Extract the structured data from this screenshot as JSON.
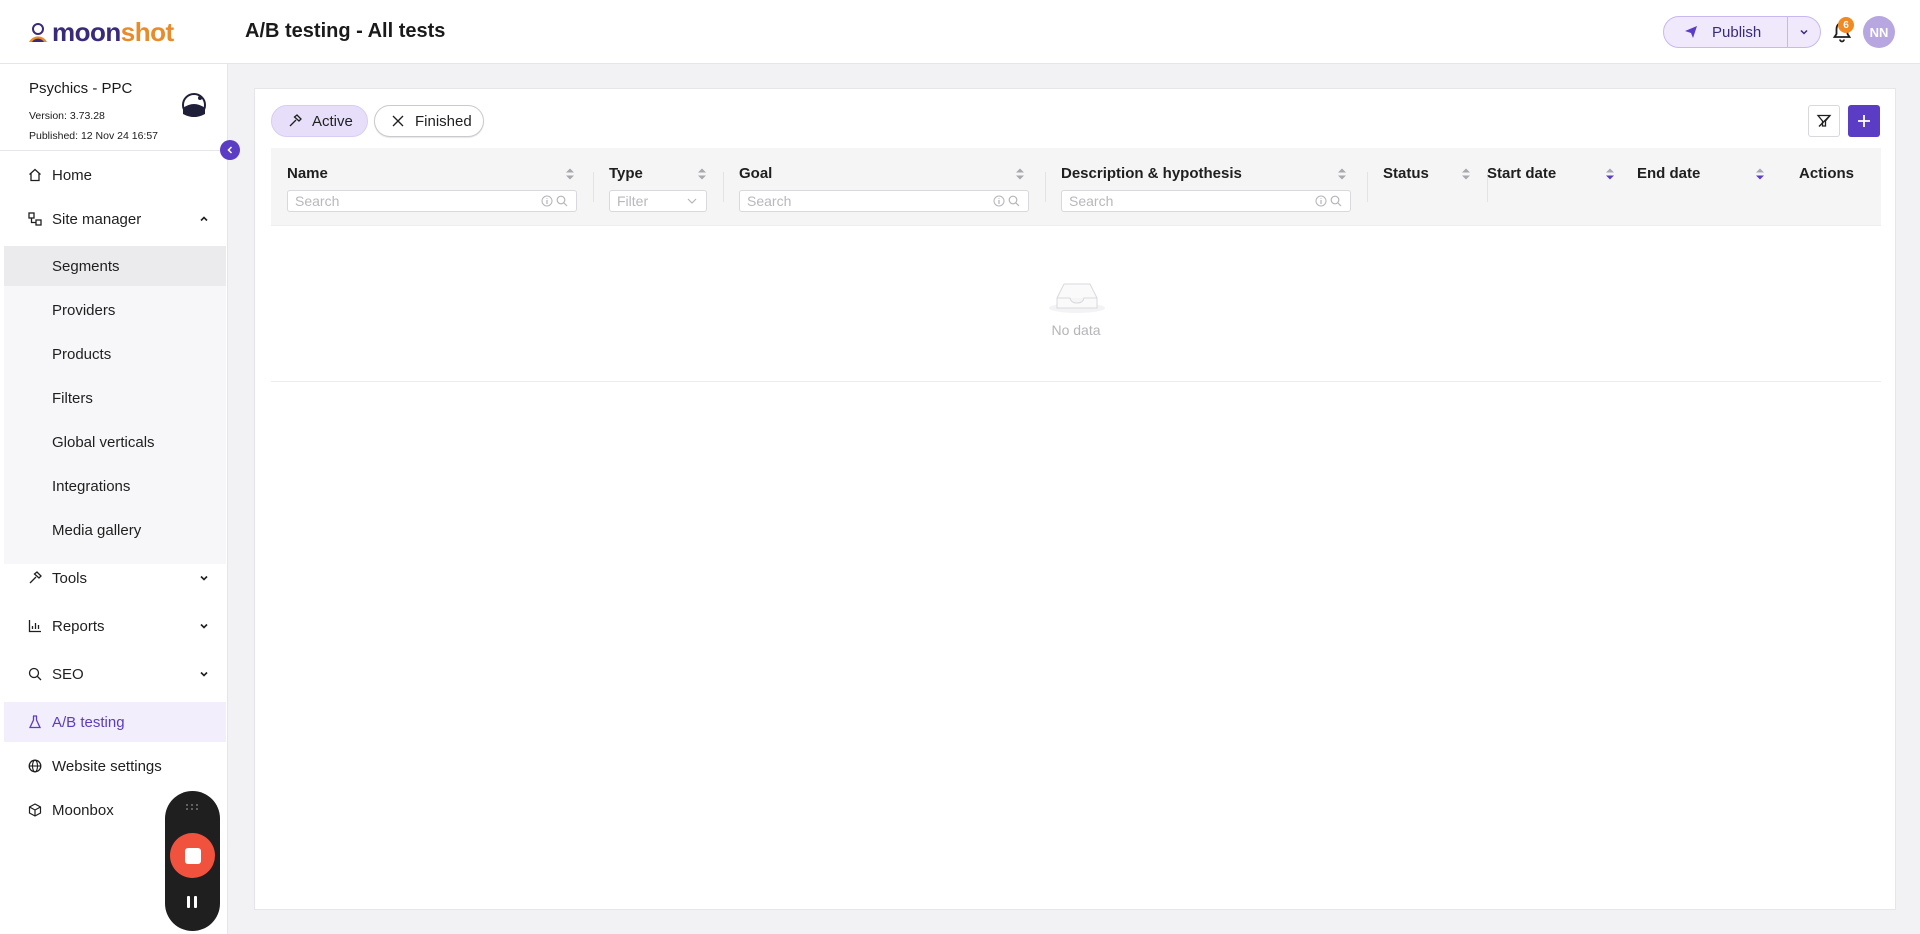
{
  "header": {
    "logo_moon": "moon",
    "logo_shot": "shot",
    "page_title": "A/B testing - All tests",
    "publish_label": "Publish",
    "notification_count": "6",
    "avatar_initials": "NN"
  },
  "site": {
    "name": "Psychics - PPC",
    "version": "Version: 3.73.28",
    "published": "Published: 12 Nov 24 16:57"
  },
  "sidebar": {
    "home": "Home",
    "site_manager": "Site manager",
    "segments": "Segments",
    "providers": "Providers",
    "products": "Products",
    "filters": "Filters",
    "global_verticals": "Global verticals",
    "integrations": "Integrations",
    "media_gallery": "Media gallery",
    "tools": "Tools",
    "reports": "Reports",
    "seo": "SEO",
    "ab_testing": "A/B testing",
    "website_settings": "Website settings",
    "moonbox": "Moonbox"
  },
  "tabs": {
    "active": "Active",
    "finished": "Finished"
  },
  "table": {
    "columns": {
      "name": "Name",
      "type": "Type",
      "goal": "Goal",
      "description": "Description & hypothesis",
      "status": "Status",
      "start_date": "Start date",
      "end_date": "End date",
      "actions": "Actions"
    },
    "placeholders": {
      "name": "Search",
      "type": "Filter",
      "goal": "Search",
      "description": "Search"
    },
    "empty_text": "No data"
  },
  "colors": {
    "accent": "#5b3cc4",
    "brand_orange": "#e98b2a",
    "record_red": "#f0523e"
  }
}
